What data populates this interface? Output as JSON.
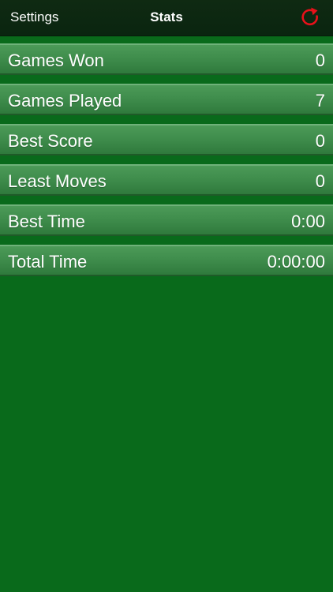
{
  "navbar": {
    "left_label": "Settings",
    "title": "Stats",
    "right_icon": "refresh-icon",
    "right_icon_color": "#e8111a"
  },
  "stats": [
    {
      "label": "Games Won",
      "value": "0"
    },
    {
      "label": "Games Played",
      "value": "7"
    },
    {
      "label": "Best Score",
      "value": "0"
    },
    {
      "label": "Least Moves",
      "value": "0"
    },
    {
      "label": "Best Time",
      "value": "0:00"
    },
    {
      "label": "Total Time",
      "value": "0:00:00"
    }
  ],
  "colors": {
    "background": "#096a1b",
    "navbar": "#0f2a12",
    "row": "#3e8c4b"
  }
}
